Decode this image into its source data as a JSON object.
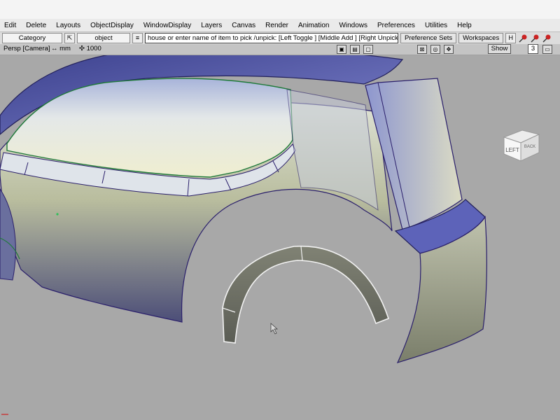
{
  "menu": [
    "Edit",
    "Delete",
    "Layouts",
    "ObjectDisplay",
    "WindowDisplay",
    "Layers",
    "Canvas",
    "Render",
    "Animation",
    "Windows",
    "Preferences",
    "Utilities",
    "Help"
  ],
  "toolbar": {
    "category_label": "Category",
    "object_label": "object",
    "pick_hint": "house or enter name of item to pick /unpick: [Left Toggle ] [Middle Add ] [Right Unpick",
    "preference_sets_label": "Preference Sets",
    "workspaces_label": "Workspaces"
  },
  "viewport": {
    "camera_label": "Persp [Camera]",
    "units_label": "↔ mm",
    "grid_label": "✣ 1000",
    "show_label": "Show",
    "count_label": "3"
  },
  "viewcube": {
    "face_left": "LEFT",
    "face_back": "BACK"
  },
  "colors": {
    "surface_blue": "#5d63b9",
    "curve_green": "#1f7a3a",
    "wire_dark": "#2a1f6b",
    "accent_red": "#cc2222"
  }
}
